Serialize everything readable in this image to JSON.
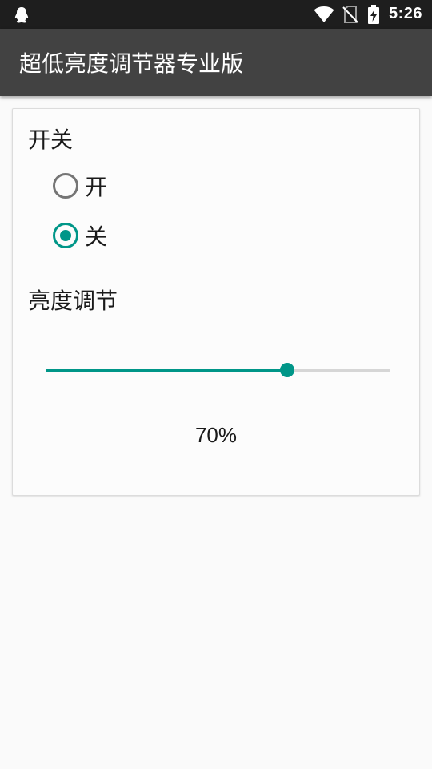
{
  "status_bar": {
    "time": "5:26",
    "icons": [
      "qq-icon",
      "wifi-icon",
      "no-sim-icon",
      "battery-charging-icon"
    ]
  },
  "app_bar": {
    "title": "超低亮度调节器专业版"
  },
  "switch_section": {
    "label": "开关",
    "options": [
      {
        "label": "开",
        "checked": false
      },
      {
        "label": "关",
        "checked": true
      }
    ]
  },
  "brightness_section": {
    "label": "亮度调节",
    "value_fraction": 0.7,
    "value_text": "70%"
  },
  "colors": {
    "accent": "#009688",
    "app_bar": "#424242",
    "status_bar": "#1e1e1e",
    "background": "#fafafa"
  }
}
